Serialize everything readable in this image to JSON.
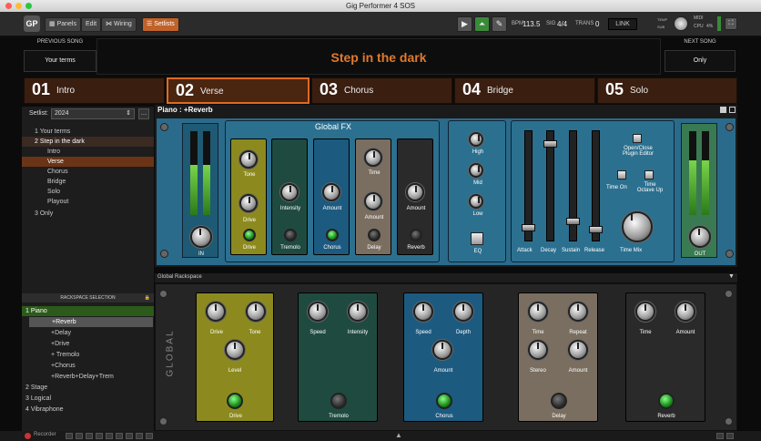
{
  "window": {
    "title": "Gig Performer 4 SOS"
  },
  "toolbar": {
    "panels": "Panels",
    "edit": "Edit",
    "wiring": "Wiring",
    "setlists": "Setlists",
    "bpm_label": "BPM",
    "bpm": "113.5",
    "sig_label": "SIG",
    "sig": "4/4",
    "trans_label": "TRANS",
    "trans": "0",
    "link": "LINK",
    "tempo_label": "TEMP",
    "sub_label": "SUB",
    "midi_label": "MIDI",
    "cpu_label": "CPU",
    "cpu": "4%"
  },
  "songs": {
    "prev_label": "PREVIOUS SONG",
    "prev": "Your terms",
    "current": "Step in the dark",
    "next_label": "NEXT SONG",
    "next": "Only"
  },
  "parts": [
    {
      "num": "01",
      "name": "Intro"
    },
    {
      "num": "02",
      "name": "Verse"
    },
    {
      "num": "03",
      "name": "Chorus"
    },
    {
      "num": "04",
      "name": "Bridge"
    },
    {
      "num": "05",
      "name": "Solo"
    }
  ],
  "setlist": {
    "label": "Setlist:",
    "value": "2024",
    "items": [
      "1  Your terms",
      "2  Step in the dark",
      "Intro",
      "Verse",
      "Chorus",
      "Bridge",
      "Solo",
      "Playout",
      "3  Only"
    ]
  },
  "rackspace": {
    "header": "RACKSPACE SELECTION",
    "items": [
      "1  Piano",
      "+Reverb",
      "+Delay",
      "+Drive",
      "+ Tremolo",
      "+Chorus",
      "+Reverb+Delay+Trem",
      "2  Stage",
      "3  Logical",
      "4  Vibraphone"
    ]
  },
  "panel": {
    "title": "Piano : +Reverb",
    "global_fx": "Global FX",
    "in": "IN",
    "out": "OUT",
    "labels": {
      "tone": "Tone",
      "drive_knob": "Drive",
      "drive_btn": "Drive",
      "intensity": "Intensity",
      "tremolo": "Tremolo",
      "amount": "Amount",
      "chorus": "Chorus",
      "time": "Time",
      "amount2": "Amount",
      "delay": "Delay",
      "amount3": "Amount",
      "reverb": "Reverb",
      "high": "High",
      "mid": "Mid",
      "low": "Low",
      "eq": "EQ",
      "attack": "Attack",
      "decay": "Decay",
      "sustain": "Sustain",
      "release": "Release",
      "open_close": "Open/Close\nPlugin Editor",
      "time_on": "Time On",
      "time_octave": "Time\nOctave Up",
      "time_mix": "Time Mix"
    }
  },
  "global_rack": {
    "title": "Global Rackspace",
    "side": "GLOBAL",
    "drive": {
      "k1": "Drive",
      "k2": "Tone",
      "k3": "Level",
      "btn": "Drive"
    },
    "tremolo": {
      "k1": "Speed",
      "k2": "Intensity",
      "btn": "Tremolo"
    },
    "chorus": {
      "k1": "Speed",
      "k2": "Depth",
      "k3": "Amount",
      "btn": "Chorus"
    },
    "delay": {
      "k1": "Time",
      "k2": "Repeat",
      "k3": "Stereo",
      "k4": "Amount",
      "btn": "Delay"
    },
    "reverb": {
      "k1": "Time",
      "k2": "Amount",
      "btn": "Reverb"
    }
  },
  "bottom": {
    "recorder": "Recorder"
  },
  "colors": {
    "accent": "#e07a2e",
    "drive": "#8c8a1e",
    "tremolo": "#1f4a40",
    "chorus": "#1d5a80",
    "delay": "#7a6e60",
    "reverb": "#2a2a2a",
    "rack_bg": "#2a6a8a"
  }
}
